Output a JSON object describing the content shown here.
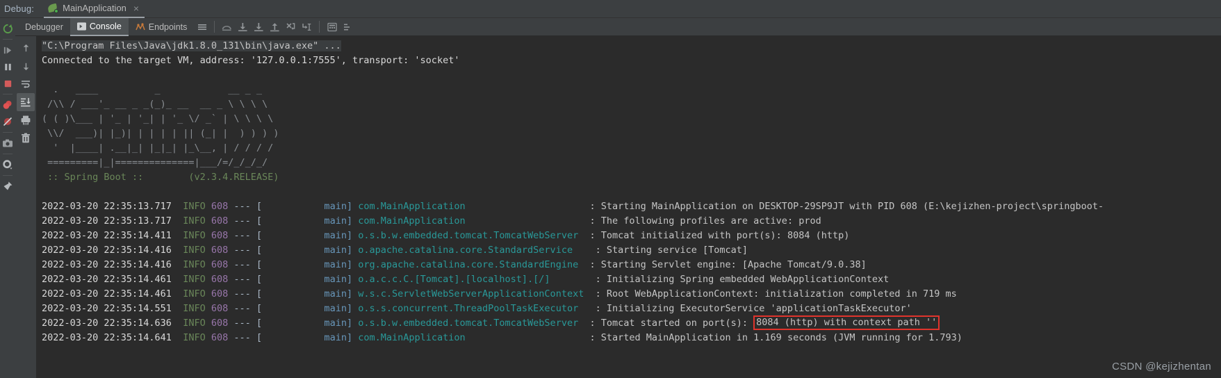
{
  "window": {
    "debug_label": "Debug:",
    "run_config_name": "MainApplication",
    "close_glyph": "×"
  },
  "toolbar": {
    "tabs": [
      {
        "label": "Debugger",
        "icon": "debugger-icon",
        "active": false
      },
      {
        "label": "Console",
        "icon": "console-icon",
        "active": true
      },
      {
        "label": "Endpoints",
        "icon": "endpoints-icon",
        "active": false
      }
    ],
    "buttons": [
      {
        "name": "layout-settings-icon",
        "title": "Layout Settings"
      },
      {
        "name": "step-over-icon",
        "title": "Step Over"
      },
      {
        "name": "step-into-icon",
        "title": "Step Into"
      },
      {
        "name": "force-step-into-icon",
        "title": "Force Step Into"
      },
      {
        "name": "step-out-icon",
        "title": "Step Out"
      },
      {
        "name": "drop-frame-icon",
        "title": "Drop Frame"
      },
      {
        "name": "run-to-cursor-icon",
        "title": "Run to Cursor"
      },
      {
        "name": "evaluate-expression-icon",
        "title": "Evaluate Expression"
      },
      {
        "name": "threads-frames-icon",
        "title": "Threads and Frames"
      }
    ]
  },
  "left_rail": [
    {
      "name": "resume-program-button",
      "title": "Resume Program"
    },
    {
      "name": "pause-program-button",
      "title": "Pause Program"
    },
    {
      "name": "stop-button",
      "title": "Stop"
    },
    {
      "name": "view-breakpoints-button",
      "title": "View Breakpoints"
    },
    {
      "name": "mute-breakpoints-button",
      "title": "Mute Breakpoints"
    },
    {
      "name": "screenshot-button",
      "title": "Screenshot"
    },
    {
      "name": "settings-button",
      "title": "Settings"
    },
    {
      "name": "pin-tab-button",
      "title": "Pin Tab"
    }
  ],
  "console_rail": [
    {
      "name": "scroll-up-button",
      "title": "Up the Stack Trace"
    },
    {
      "name": "scroll-down-button",
      "title": "Down the Stack Trace"
    },
    {
      "name": "soft-wrap-button",
      "title": "Use Soft Wraps"
    },
    {
      "name": "scroll-to-end-button",
      "title": "Scroll to End",
      "toggled": true
    },
    {
      "name": "print-button",
      "title": "Print"
    },
    {
      "name": "clear-all-button",
      "title": "Clear All"
    }
  ],
  "console": {
    "command_line": "\"C:\\Program Files\\Java\\jdk1.8.0_131\\bin\\java.exe\" ...",
    "connected_line": "Connected to the target VM, address: '127.0.0.1:7555', transport: 'socket'",
    "banner": [
      "  .   ____          _            __ _ _",
      " /\\\\ / ___'_ __ _ _(_)_ __  __ _ \\ \\ \\ \\",
      "( ( )\\___ | '_ | '_| | '_ \\/ _` | \\ \\ \\ \\",
      " \\\\/  ___)| |_)| | | | | || (_| |  ) ) ) )",
      "  '  |____| .__|_| |_|_| |_\\__, | / / / /",
      " =========|_|==============|___/=/_/_/_/"
    ],
    "banner_version_prefix": " :: Spring Boot :: ",
    "banner_version": "       (v2.3.4.RELEASE)",
    "highlight": {
      "text": "8084 (http) with context path ''",
      "border_color": "#e0342c"
    },
    "log_lines": [
      {
        "time": "2022-03-20 22:35:13.717",
        "level": "INFO",
        "pid": "608",
        "sep": "--- [",
        "thread": "           main]",
        "logger": "com.MainApplication",
        "logger_pad": "                    ",
        "message": ": Starting MainApplication on DESKTOP-29SP9JT with PID 608 (E:\\kejizhen-project\\springboot-"
      },
      {
        "time": "2022-03-20 22:35:13.717",
        "level": "INFO",
        "pid": "608",
        "sep": "--- [",
        "thread": "           main]",
        "logger": "com.MainApplication",
        "logger_pad": "                    ",
        "message": ": The following profiles are active: prod"
      },
      {
        "time": "2022-03-20 22:35:14.411",
        "level": "INFO",
        "pid": "608",
        "sep": "--- [",
        "thread": "           main]",
        "logger": "o.s.b.w.embedded.tomcat.TomcatWebServer",
        "logger_pad": "",
        "message": ": Tomcat initialized with port(s): 8084 (http)"
      },
      {
        "time": "2022-03-20 22:35:14.416",
        "level": "INFO",
        "pid": "608",
        "sep": "--- [",
        "thread": "           main]",
        "logger": "o.apache.catalina.core.StandardService",
        "logger_pad": "  ",
        "message": ": Starting service [Tomcat]"
      },
      {
        "time": "2022-03-20 22:35:14.416",
        "level": "INFO",
        "pid": "608",
        "sep": "--- [",
        "thread": "           main]",
        "logger": "org.apache.catalina.core.StandardEngine",
        "logger_pad": "",
        "message": ": Starting Servlet engine: [Apache Tomcat/9.0.38]"
      },
      {
        "time": "2022-03-20 22:35:14.461",
        "level": "INFO",
        "pid": "608",
        "sep": "--- [",
        "thread": "           main]",
        "logger": "o.a.c.c.C.[Tomcat].[localhost].[/]",
        "logger_pad": "      ",
        "message": ": Initializing Spring embedded WebApplicationContext"
      },
      {
        "time": "2022-03-20 22:35:14.461",
        "level": "INFO",
        "pid": "608",
        "sep": "--- [",
        "thread": "           main]",
        "logger": "w.s.c.ServletWebServerApplicationContext",
        "logger_pad": "",
        "message": ": Root WebApplicationContext: initialization completed in 719 ms"
      },
      {
        "time": "2022-03-20 22:35:14.551",
        "level": "INFO",
        "pid": "608",
        "sep": "--- [",
        "thread": "           main]",
        "logger": "o.s.s.concurrent.ThreadPoolTaskExecutor",
        "logger_pad": " ",
        "message": ": Initializing ExecutorService 'applicationTaskExecutor'"
      },
      {
        "time": "2022-03-20 22:35:14.636",
        "level": "INFO",
        "pid": "608",
        "sep": "--- [",
        "thread": "           main]",
        "logger": "o.s.b.w.embedded.tomcat.TomcatWebServer",
        "logger_pad": "",
        "message": ": Tomcat started on port(s): ",
        "highlighted": true
      },
      {
        "time": "2022-03-20 22:35:14.641",
        "level": "INFO",
        "pid": "608",
        "sep": "--- [",
        "thread": "           main]",
        "logger": "com.MainApplication",
        "logger_pad": "                    ",
        "message": ": Started MainApplication in 1.169 seconds (JVM running for 1.793)"
      }
    ]
  },
  "watermark": "CSDN @kejizhentan",
  "colors": {
    "background": "#3c3f41",
    "console_bg": "#2b2b2b",
    "text": "#a9b7c6",
    "level_info": "#6a8759",
    "pid": "#9876aa",
    "logger": "#299999",
    "thread": "#6897bb",
    "highlight_border": "#e0342c"
  }
}
